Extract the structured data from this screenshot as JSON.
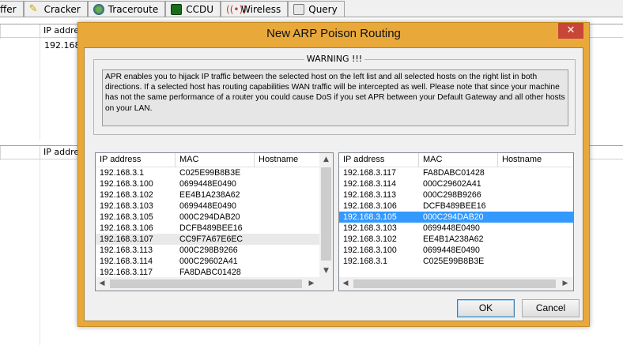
{
  "background": {
    "tabs": [
      {
        "label": "ffer",
        "icon": "none"
      },
      {
        "label": "Cracker",
        "icon": "cracker-icon"
      },
      {
        "label": "Traceroute",
        "icon": "traceroute-icon"
      },
      {
        "label": "CCDU",
        "icon": "ccdu-icon"
      },
      {
        "label": "Wireless",
        "icon": "wireless-icon"
      },
      {
        "label": "Query",
        "icon": "query-icon"
      }
    ],
    "top_header": "IP addre",
    "top_row": "192.168.",
    "bottom_header": "IP addre"
  },
  "dialog": {
    "title": "New ARP Poison Routing",
    "close_glyph": "✕",
    "warning_label": "WARNING !!!",
    "warning_text": "APR enables you to hijack IP traffic between the selected host on the left list and all selected hosts on the right list in both directions. If a selected host has routing capabilities WAN traffic will be intercepted as well. Please note that since your machine has not the same performance of a router you could cause DoS if you set APR between your Default Gateway and all other hosts on your LAN.",
    "columns": [
      "IP address",
      "MAC",
      "Hostname"
    ],
    "left_list": [
      {
        "ip": "192.168.3.1",
        "mac": "C025E99B8B3E"
      },
      {
        "ip": "192.168.3.100",
        "mac": "0699448E0490"
      },
      {
        "ip": "192.168.3.102",
        "mac": "EE4B1A238A62"
      },
      {
        "ip": "192.168.3.103",
        "mac": "0699448E0490"
      },
      {
        "ip": "192.168.3.105",
        "mac": "000C294DAB20"
      },
      {
        "ip": "192.168.3.106",
        "mac": "DCFB489BEE16"
      },
      {
        "ip": "192.168.3.107",
        "mac": "CC9F7A67E6EC"
      },
      {
        "ip": "192.168.3.113",
        "mac": "000C298B9266"
      },
      {
        "ip": "192.168.3.114",
        "mac": "000C29602A41"
      },
      {
        "ip": "192.168.3.117",
        "mac": "FA8DABC01428"
      }
    ],
    "right_list": [
      {
        "ip": "192.168.3.117",
        "mac": "FA8DABC01428"
      },
      {
        "ip": "192.168.3.114",
        "mac": "000C29602A41"
      },
      {
        "ip": "192.168.3.113",
        "mac": "000C298B9266"
      },
      {
        "ip": "192.168.3.106",
        "mac": "DCFB489BEE16"
      },
      {
        "ip": "192.168.3.105",
        "mac": "000C294DAB20"
      },
      {
        "ip": "192.168.3.103",
        "mac": "0699448E0490"
      },
      {
        "ip": "192.168.3.102",
        "mac": "EE4B1A238A62"
      },
      {
        "ip": "192.168.3.100",
        "mac": "0699448E0490"
      },
      {
        "ip": "192.168.3.1",
        "mac": "C025E99B8B3E"
      }
    ],
    "left_hover_index": 6,
    "right_selected_index": 4,
    "ok_label": "OK",
    "cancel_label": "Cancel",
    "colors": {
      "frame": "#e9a93a",
      "close": "#c74637",
      "selection": "#3399ff"
    }
  }
}
